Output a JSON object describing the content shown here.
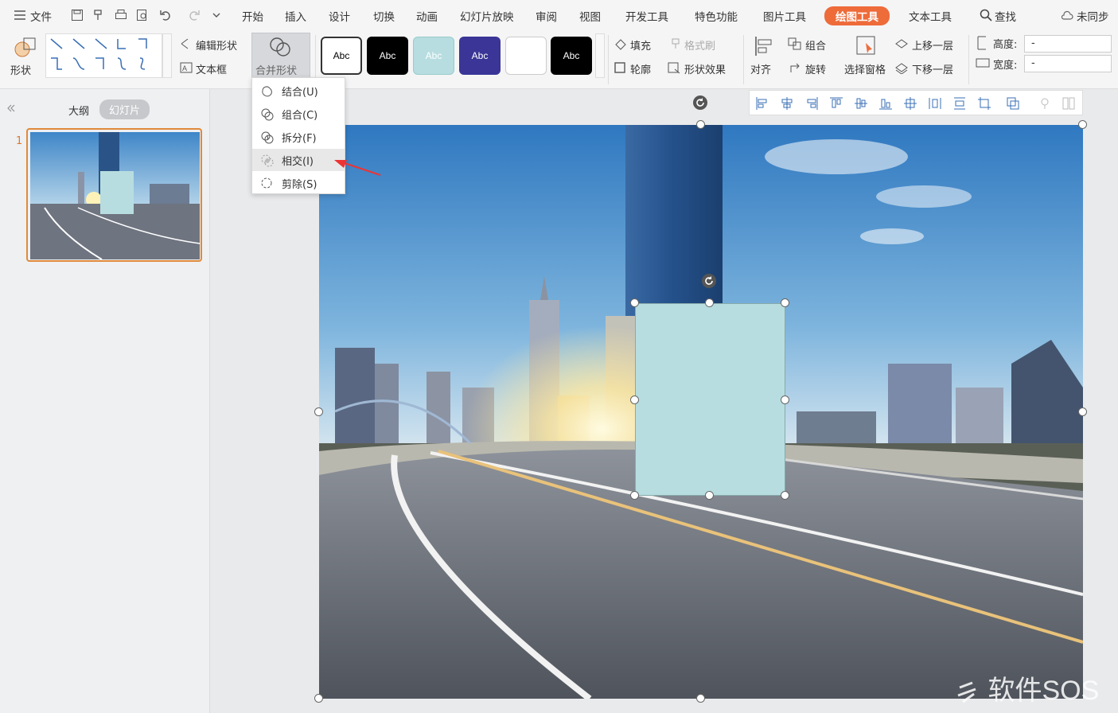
{
  "menu": {
    "file": "文件",
    "tabs": [
      "开始",
      "插入",
      "设计",
      "切换",
      "动画",
      "幻灯片放映",
      "审阅",
      "视图",
      "开发工具",
      "特色功能",
      "图片工具",
      "绘图工具",
      "文本工具"
    ],
    "search": "查找",
    "sync": "未同步"
  },
  "ribbon": {
    "shape": "形状",
    "edit_shape": "编辑形状",
    "textbox": "文本框",
    "merge_shape": "合并形状",
    "styles": [
      "Abc",
      "Abc",
      "Abc",
      "Abc",
      "",
      "Abc"
    ],
    "fill": "填充",
    "format_brush": "格式刷",
    "outline": "轮廓",
    "shape_effect": "形状效果",
    "align": "对齐",
    "group": "组合",
    "rotate": "旋转",
    "selection_pane": "选择窗格",
    "bring_forward": "上移一层",
    "send_backward": "下移一层",
    "height_label": "高度:",
    "width_label": "宽度:",
    "height_value": "-",
    "width_value": "-"
  },
  "panel": {
    "outline_tab": "大纲",
    "slides_tab": "幻灯片",
    "slide_number": "1"
  },
  "merge_menu": {
    "items": [
      "结合(U)",
      "组合(C)",
      "拆分(F)",
      "相交(I)",
      "剪除(S)"
    ]
  },
  "watermark": "软件SOS",
  "colors": {
    "accent": "#ee6b3a",
    "shape_fill": "#b7dde0",
    "selection": "#e08a3a"
  }
}
